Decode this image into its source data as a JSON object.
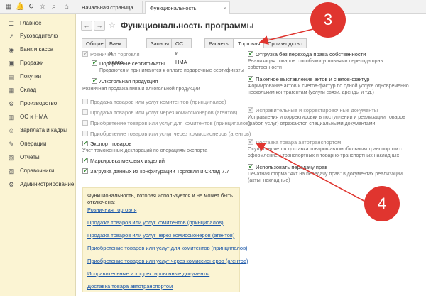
{
  "topbar": {
    "home_tab": "Начальная страница",
    "active_tab": "Функциональность программы",
    "close_glyph": "×"
  },
  "sidebar": {
    "items": [
      {
        "label": "Главное",
        "icon": "☰"
      },
      {
        "label": "Руководителю",
        "icon": "↗"
      },
      {
        "label": "Банк и касса",
        "icon": "◉"
      },
      {
        "label": "Продажи",
        "icon": "▣"
      },
      {
        "label": "Покупки",
        "icon": "▤"
      },
      {
        "label": "Склад",
        "icon": "▦"
      },
      {
        "label": "Производство",
        "icon": "⚙"
      },
      {
        "label": "ОС и НМА",
        "icon": "▥"
      },
      {
        "label": "Зарплата и кадры",
        "icon": "☺"
      },
      {
        "label": "Операции",
        "icon": "✎"
      },
      {
        "label": "Отчеты",
        "icon": "▧"
      },
      {
        "label": "Справочники",
        "icon": "▨"
      },
      {
        "label": "Администрирование",
        "icon": "⚙"
      }
    ]
  },
  "page": {
    "title": "Функциональность программы",
    "back": "←",
    "forward": "→",
    "star": "☆"
  },
  "tabs": [
    "Общие",
    "Банк и касса",
    "Запасы",
    "ОС и НМА",
    "Расчеты",
    "Торговля",
    "Производство"
  ],
  "left_options": [
    {
      "label": "Розничная торговля",
      "checked": true,
      "disabled": true
    },
    {
      "label": "Подарочные сертификаты",
      "checked": true,
      "disabled": false
    },
    {
      "hint": "Продаются и принимаются к оплате подарочные сертификаты"
    },
    {
      "label": "Алкогольная продукция",
      "checked": true,
      "disabled": false
    },
    {
      "hint": "Розничная продажа пива и алкогольной продукции"
    },
    {
      "label": "Продажа товаров или услуг комитентов (принципалов)",
      "checked": false,
      "disabled": true
    },
    {
      "label": "Продажа товаров или услуг через комиссионеров (агентов)",
      "checked": false,
      "disabled": true
    },
    {
      "label": "Приобретение товаров или услуг для комитентов (принципалов)",
      "checked": false,
      "disabled": true
    },
    {
      "label": "Приобретение товаров или услуг через комиссионеров (агентов)",
      "checked": false,
      "disabled": true
    },
    {
      "label": "Экспорт товаров",
      "checked": true,
      "disabled": false
    },
    {
      "hint": "Учет таможенных деклараций по операциям экспорта"
    },
    {
      "label": "Маркировка меховых изделий",
      "checked": true,
      "disabled": false
    },
    {
      "label": "Загрузка данных из конфигурации Торговля и Склад 7.7",
      "checked": true,
      "disabled": false
    }
  ],
  "right_options": [
    {
      "label": "Отгрузка без перехода права собственности",
      "checked": true,
      "disabled": false
    },
    {
      "hint": "Реализация товаров с особыми условиями перехода прав собственности"
    },
    {
      "label": "Пакетное выставление актов и счетов-фактур",
      "checked": true,
      "disabled": false
    },
    {
      "hint": "Формирование актов и счетов-фактур по одной услуге одновременно нескольким контрагентам (услуги связи, аренды и т.д.)"
    },
    {
      "label": "Исправительные и корректировочные документы",
      "checked": true,
      "disabled": true
    },
    {
      "hint": "Исправления и корректировки в поступлении и реализации товаров (работ, услуг) отражаются специальными документами"
    },
    {
      "label": "Доставка товара автотранспортом",
      "checked": true,
      "disabled": true
    },
    {
      "hint": "Осуществляется доставка товаров автомобильным транспортом с оформлением транспортных и товарно-транспортных накладных"
    },
    {
      "label": "Использовать передачу прав",
      "checked": true,
      "disabled": false
    },
    {
      "hint": "Печатная форма \"Акт на передачу прав\" в документах реализации (акты, накладные)"
    }
  ],
  "used_box": {
    "heading": "Функциональность, которая используется и не может быть отключена:",
    "links": [
      "Розничная торговля",
      "Продажа товаров или услуг комитентов (принципалов)",
      "Продажа товаров или услуг через комиссионеров (агентов)",
      "Приобретение товаров или услуг для комитентов (принципалов)",
      "Приобретение товаров или услуг через комиссионеров (агентов)",
      "Исправительные и корректировочные документы",
      "Доставка товара автотранспортом"
    ]
  },
  "annotations": {
    "badge_3": "3",
    "badge_4": "4",
    "color": "#e0352f"
  }
}
